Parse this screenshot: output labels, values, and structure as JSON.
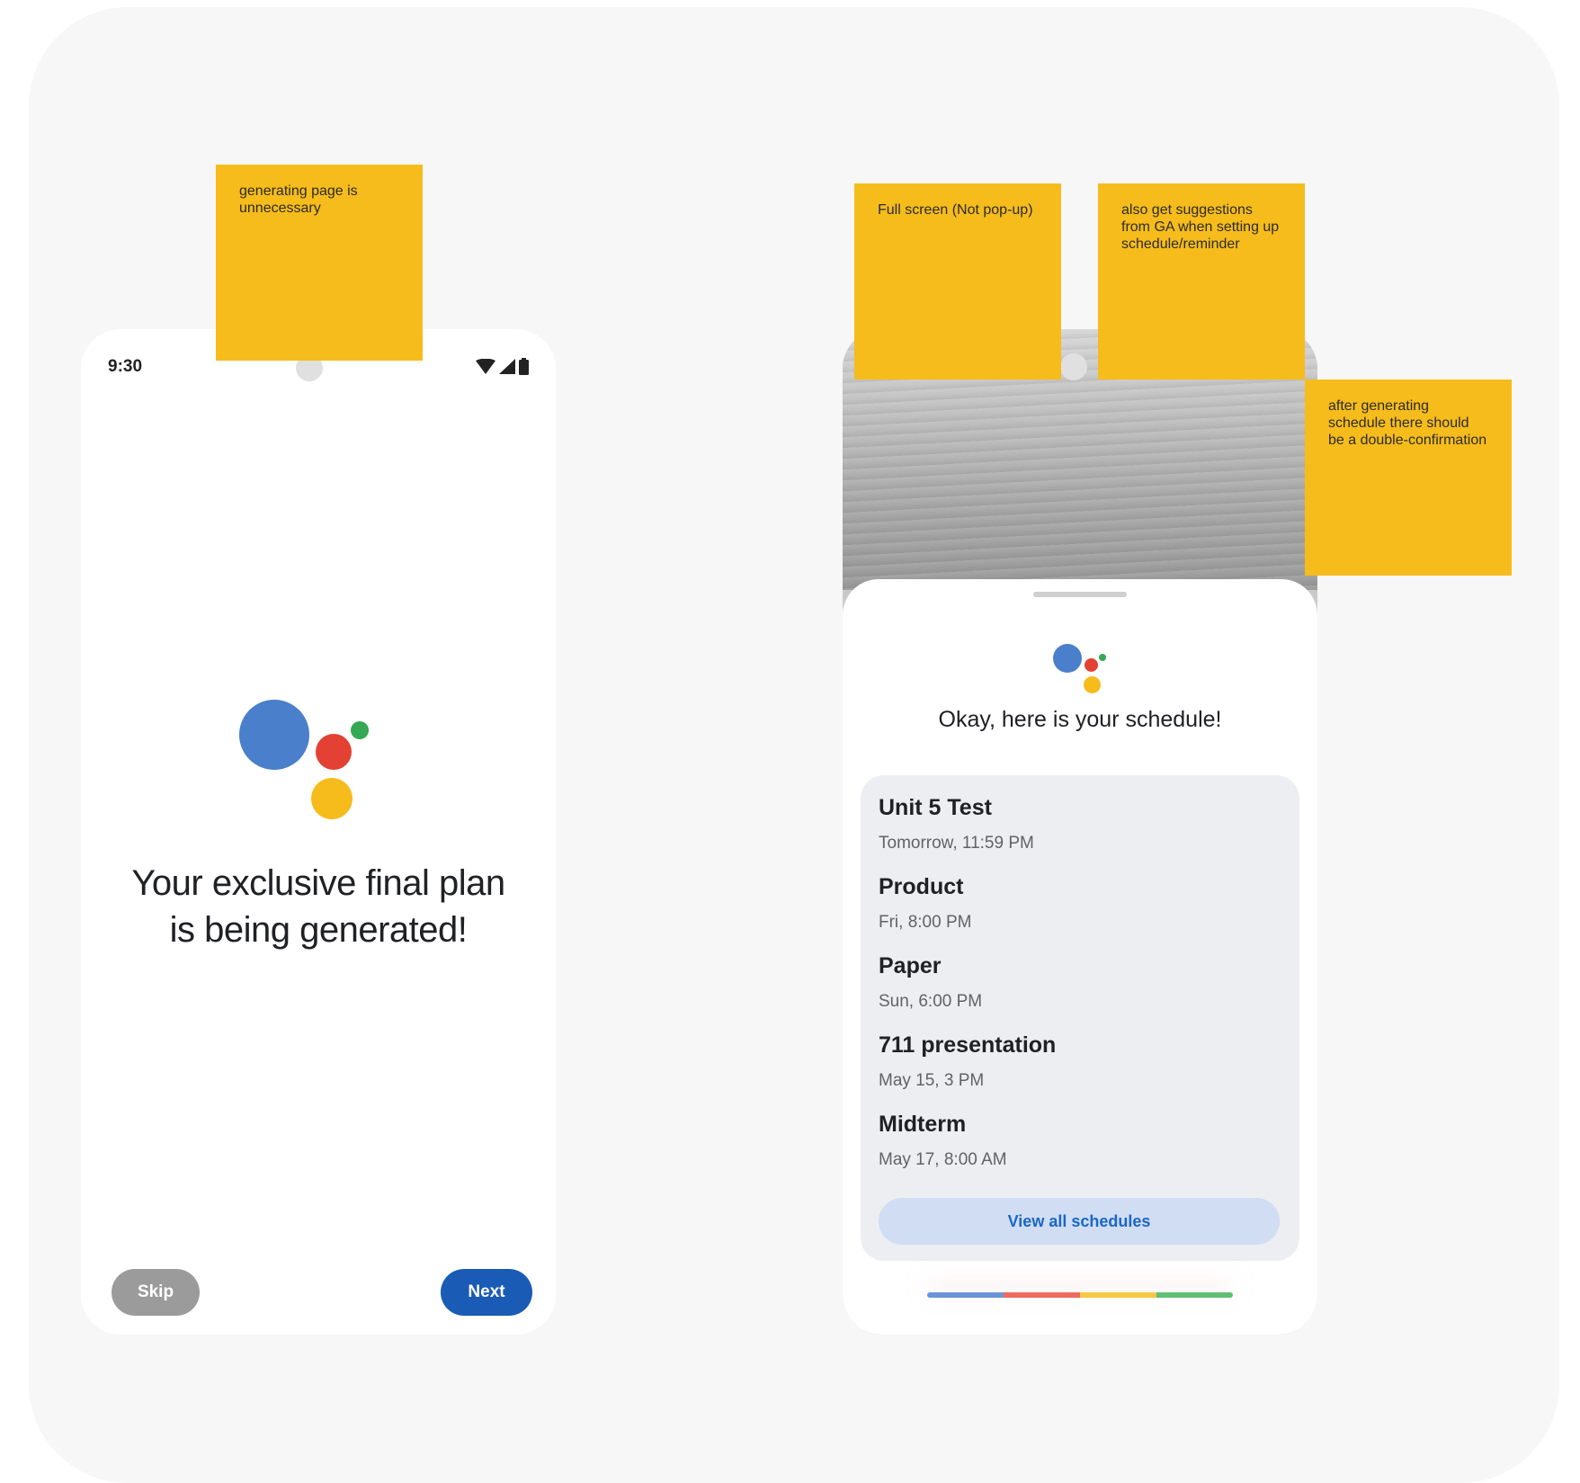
{
  "colors": {
    "board_bg": "#f7f7f7",
    "sticky": "#f6bc1b",
    "assistant_blue": "#4a7fcb",
    "assistant_red": "#e34133",
    "assistant_yellow": "#f5bc1c",
    "assistant_green": "#34a853",
    "next_button": "#1a5bb5",
    "skip_button": "#9b9b9b"
  },
  "screen1": {
    "status_time": "9:30",
    "status_icons": [
      "wifi-icon",
      "signal-icon",
      "battery-icon"
    ],
    "headline_line1": "Your exclusive final plan",
    "headline_line2": "is being generated!",
    "skip_label": "Skip",
    "next_label": "Next"
  },
  "screen2": {
    "title": "Okay, here is your schedule!",
    "schedules": [
      {
        "title": "Unit 5 Test",
        "when": "Tomorrow, 11:59 PM"
      },
      {
        "title": "Product",
        "when": "Fri, 8:00 PM"
      },
      {
        "title": "Paper",
        "when": "Sun, 6:00 PM"
      },
      {
        "title": "711 presentation",
        "when": "May 15, 3 PM"
      },
      {
        "title": "Midterm",
        "when": "May 17, 8:00 AM"
      }
    ],
    "view_all_label": "View all schedules"
  },
  "stickies": {
    "generating": "generating page is unnecessary",
    "full_screen": "Full screen (Not pop-up)",
    "suggestions": "also get suggestions from GA when setting up schedule/reminder",
    "confirmation": "after generating schedule there should be a double-confirmation"
  }
}
